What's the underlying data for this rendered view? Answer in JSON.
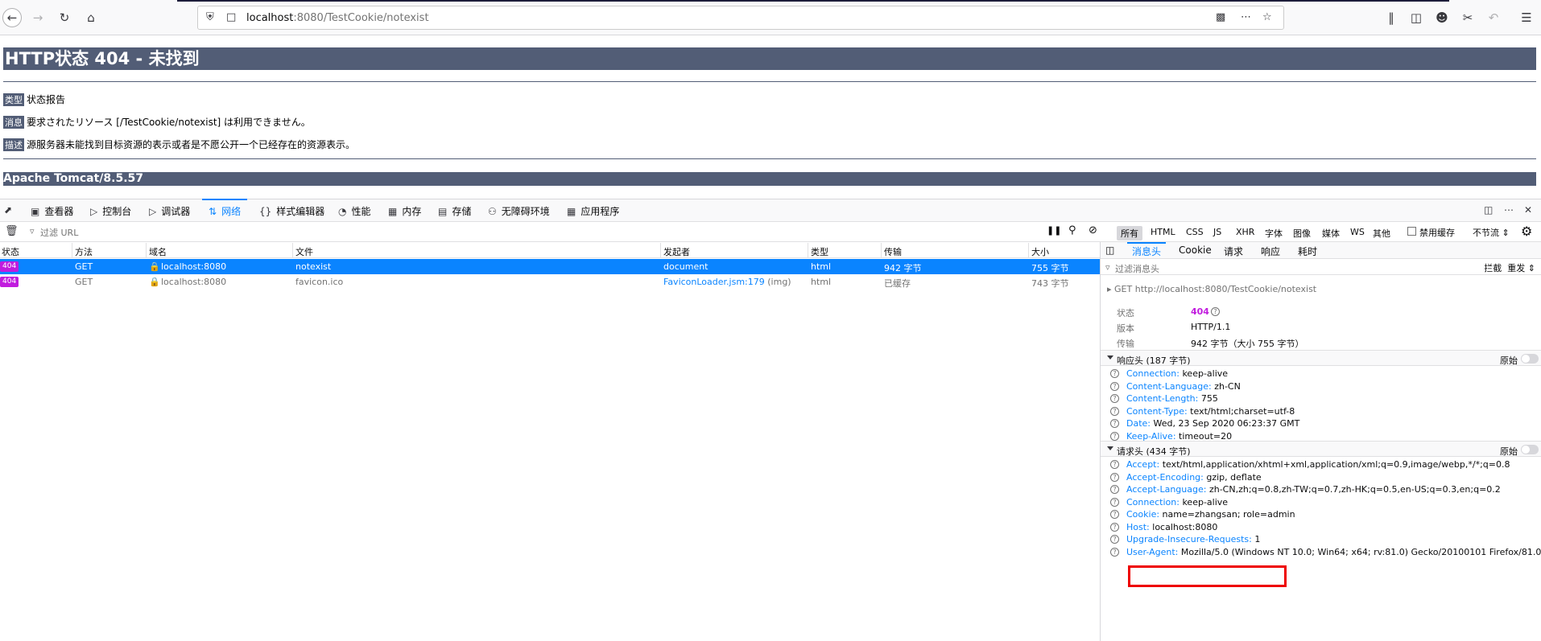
{
  "browser": {
    "url_host": "localhost",
    "url_rest": ":8080/TestCookie/notexist"
  },
  "page": {
    "title": "HTTP状态 404 - 未找到",
    "type_label": "类型",
    "type_value": "状态报告",
    "message_label": "消息",
    "message_value": "要求されたリソース [/TestCookie/notexist] は利用できません。",
    "description_label": "描述",
    "description_value": "源服务器未能找到目标资源的表示或者是不愿公开一个已经存在的资源表示。",
    "footer": "Apache Tomcat/8.5.57"
  },
  "devtools": {
    "tabs": [
      "查看器",
      "控制台",
      "调试器",
      "网络",
      "样式编辑器",
      "性能",
      "内存",
      "存储",
      "无障碍环境",
      "应用程序"
    ],
    "selected_tab": "网络",
    "filter_placeholder": "过滤 URL",
    "type_filters": [
      "所有",
      "HTML",
      "CSS",
      "JS",
      "XHR",
      "字体",
      "图像",
      "媒体",
      "WS",
      "其他"
    ],
    "disable_cache": "禁用缓存",
    "throttle": "不节流 ⇕",
    "columns": [
      "状态",
      "方法",
      "域名",
      "文件",
      "发起者",
      "类型",
      "传输",
      "大小"
    ],
    "requests": [
      {
        "status": "404",
        "method": "GET",
        "domain": "localhost:8080",
        "file": "notexist",
        "initiator": "document",
        "initiator_extra": "",
        "type": "html",
        "transferred": "942 字节",
        "size": "755 字节"
      },
      {
        "status": "404",
        "method": "GET",
        "domain": "localhost:8080",
        "file": "favicon.ico",
        "initiator": "FaviconLoader.jsm:179",
        "initiator_extra": "(img)",
        "type": "html",
        "transferred": "已缓存",
        "size": "743 字节"
      }
    ]
  },
  "panel": {
    "tabs": [
      "消息头",
      "Cookie",
      "请求",
      "响应",
      "耗时"
    ],
    "filter_placeholder": "过滤消息头",
    "block_label": "拦截",
    "resend_label": "重发 ⇕",
    "request_line_method": "GET",
    "request_line_url": "http://localhost:8080/TestCookie/notexist",
    "status_label": "状态",
    "status_value": "404",
    "version_label": "版本",
    "version_value": "HTTP/1.1",
    "transfer_label": "传输",
    "transfer_value": "942 字节（大小 755 字节）",
    "raw_label": "原始",
    "response_headers_title": "响应头 (187 字节)",
    "response_headers": [
      {
        "name": "Connection:",
        "value": "keep-alive"
      },
      {
        "name": "Content-Language:",
        "value": "zh-CN"
      },
      {
        "name": "Content-Length:",
        "value": "755"
      },
      {
        "name": "Content-Type:",
        "value": "text/html;charset=utf-8"
      },
      {
        "name": "Date:",
        "value": "Wed, 23 Sep 2020 06:23:37 GMT"
      },
      {
        "name": "Keep-Alive:",
        "value": "timeout=20"
      }
    ],
    "request_headers_title": "请求头 (434 字节)",
    "request_headers": [
      {
        "name": "Accept:",
        "value": "text/html,application/xhtml+xml,application/xml;q=0.9,image/webp,*/*;q=0.8"
      },
      {
        "name": "Accept-Encoding:",
        "value": "gzip, deflate"
      },
      {
        "name": "Accept-Language:",
        "value": "zh-CN,zh;q=0.8,zh-TW;q=0.7,zh-HK;q=0.5,en-US;q=0.3,en;q=0.2"
      },
      {
        "name": "Connection:",
        "value": "keep-alive"
      },
      {
        "name": "Cookie:",
        "value": "name=zhangsan; role=admin"
      },
      {
        "name": "Host:",
        "value": "localhost:8080"
      },
      {
        "name": "Upgrade-Insecure-Requests:",
        "value": "1"
      },
      {
        "name": "User-Agent:",
        "value": "Mozilla/5.0 (Windows NT 10.0; Win64; x64; rv:81.0) Gecko/20100101 Firefox/81.0"
      }
    ]
  },
  "icons": [
    "back-icon",
    "forward-icon",
    "reload-icon",
    "home-icon",
    "shield-icon",
    "page-icon",
    "qr-icon",
    "more-icon",
    "star-icon",
    "library-icon",
    "sidebar-icon",
    "account-icon",
    "screenshot-icon",
    "undo-icon",
    "menu-icon"
  ]
}
